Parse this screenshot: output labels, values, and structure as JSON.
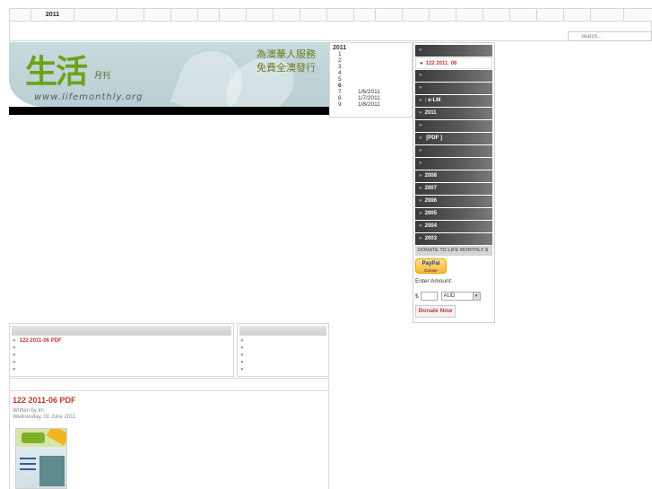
{
  "topnav": {
    "cells": [
      "",
      "2011",
      "",
      "",
      "",
      "",
      "",
      "",
      "",
      "",
      "",
      "",
      "",
      "",
      "",
      "",
      "",
      "",
      "",
      "",
      "",
      ""
    ]
  },
  "search": {
    "placeholder": "search..."
  },
  "banner": {
    "logo": "生活",
    "logo_sub": "月刊",
    "url": "www.lifemonthly.org",
    "slogan_line1": "為澳華人服務",
    "slogan_line2": "免費全澳發行"
  },
  "issues": {
    "year": "2011",
    "rows": [
      {
        "num": "1",
        "date": ""
      },
      {
        "num": "2",
        "date": ""
      },
      {
        "num": "3",
        "date": ""
      },
      {
        "num": "4",
        "date": ""
      },
      {
        "num": "5",
        "date": ""
      },
      {
        "num": "6",
        "date": ""
      },
      {
        "num": "7",
        "date": "1/6/2011"
      },
      {
        "num": "8",
        "date": "1/7/2011"
      },
      {
        "num": "9",
        "date": "1/8/2011"
      }
    ]
  },
  "sidebar": {
    "items": [
      {
        "label": ""
      },
      {
        "label": "122  2011_06"
      },
      {
        "label": ""
      },
      {
        "label": ""
      },
      {
        "label": ":      e-LM"
      },
      {
        "label": "2011"
      },
      {
        "label": ""
      },
      {
        "label": "      [PDF ]"
      },
      {
        "label": ""
      },
      {
        "label": ""
      },
      {
        "label": "2008"
      },
      {
        "label": "2007"
      },
      {
        "label": "2006"
      },
      {
        "label": "2005"
      },
      {
        "label": "2004"
      },
      {
        "label": "2003"
      }
    ],
    "donate_header": "DONATE TO LIFE MONTHLY $",
    "paypal_label": "PayPal",
    "paypal_sub": "Donate",
    "amount_label": "Enter Amount:",
    "currency_sign": "$",
    "currency": "AUD",
    "donate_now": "Donate Now"
  },
  "left_panel": {
    "rows": [
      "122   2011-06          PDF",
      "",
      "",
      "",
      ""
    ]
  },
  "right_panel": {
    "rows": [
      "",
      "",
      "",
      "",
      ""
    ]
  },
  "article": {
    "title": "122    2011-06          PDF",
    "written_by": "Written by lm",
    "date": "Wednesday, 01 June 2011"
  },
  "colors": {
    "accent": "#c0392b",
    "sidebar_dark": "#3a3a3a",
    "banner": "#c7d9dc"
  },
  "icons": {
    "bullet": "bullet-icon",
    "dropdown": "chevron-down-icon"
  }
}
